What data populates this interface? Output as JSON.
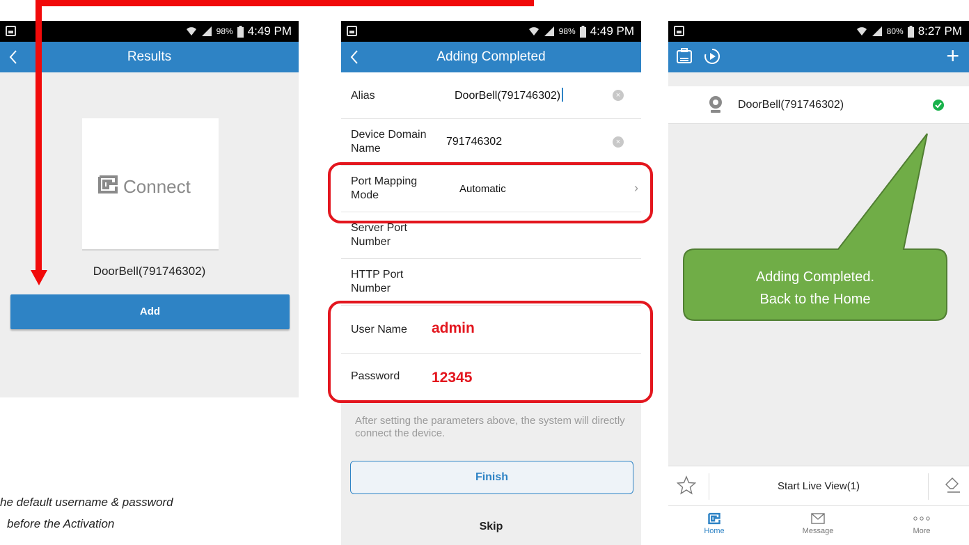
{
  "status_left": {
    "battery": "98%",
    "time": "4:49 PM"
  },
  "status_mid": {
    "battery": "98%",
    "time": "4:49 PM"
  },
  "status_right": {
    "battery": "80%",
    "time": "8:27 PM"
  },
  "results_screen": {
    "title": "Results",
    "logo_text": "Connect",
    "device_name": "DoorBell(791746302)",
    "add_label": "Add"
  },
  "adding_screen": {
    "title": "Adding Completed",
    "rows": [
      {
        "label": "Alias",
        "value": "DoorBell(791746302)"
      },
      {
        "label": "Device Domain Name",
        "value": "791746302"
      },
      {
        "label": "Port Mapping Mode",
        "value": "Automatic"
      },
      {
        "label": "Server Port Number",
        "value": ""
      },
      {
        "label": "HTTP Port Number",
        "value": ""
      },
      {
        "label": "User Name",
        "value": "admin"
      },
      {
        "label": "Password",
        "value": "12345"
      }
    ],
    "hint": "After setting the parameters above, the system will directly connect the device.",
    "finish_label": "Finish",
    "skip_label": "Skip"
  },
  "home_screen": {
    "device_name": "DoorBell(791746302)",
    "live_view_label": "Start Live View(1)",
    "tabs": [
      {
        "label": "Home",
        "icon": "hik-connect-icon"
      },
      {
        "label": "Message",
        "icon": "envelope-icon"
      },
      {
        "label": "More",
        "icon": "more-dots-icon"
      }
    ]
  },
  "annotations": {
    "callout_line1": "Adding Completed.",
    "callout_line2": "Back to the Home",
    "note_line1": "he default username & password",
    "note_line2": "before the Activation"
  },
  "colors": {
    "header": "#2e83c5",
    "highlight": "#e3161e",
    "callout": "#70ad47",
    "success": "#19b24b"
  }
}
